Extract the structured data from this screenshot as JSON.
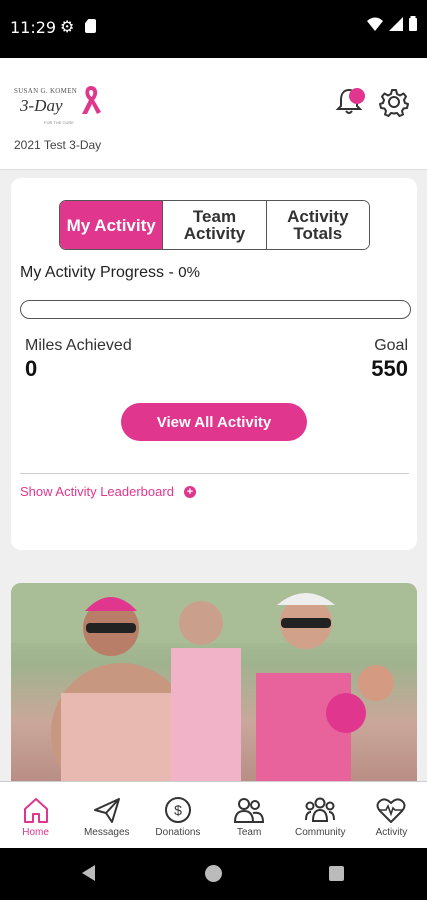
{
  "status_bar": {
    "time": "11:29"
  },
  "header": {
    "logo_org": "SUSAN G. KOMEN",
    "logo_event": "3-Day",
    "logo_tag": "FOR THE CURE",
    "event_name": "2021 Test 3-Day",
    "colors": {
      "accent": "#e0368d"
    }
  },
  "activity": {
    "tabs": [
      {
        "label": "My Activity",
        "active": true
      },
      {
        "label": "Team Activity",
        "active": false
      },
      {
        "label": "Activity Totals",
        "active": false
      }
    ],
    "progress_title": "My Activity Progress -",
    "progress_percent_text": "0%",
    "progress_fraction": 0,
    "miles_label": "Miles Achieved",
    "miles_value": "0",
    "goal_label": "Goal",
    "goal_value": "550",
    "view_all_label": "View All Activity",
    "leaderboard_link": "Show Activity Leaderboard"
  },
  "bottom_nav": [
    {
      "label": "Home",
      "icon": "home-icon",
      "active": true
    },
    {
      "label": "Messages",
      "icon": "paper-plane-icon",
      "active": false
    },
    {
      "label": "Donations",
      "icon": "dollar-circle-icon",
      "active": false
    },
    {
      "label": "Team",
      "icon": "team-icon",
      "active": false
    },
    {
      "label": "Community",
      "icon": "community-icon",
      "active": false
    },
    {
      "label": "Activity",
      "icon": "heartbeat-icon",
      "active": false
    }
  ]
}
